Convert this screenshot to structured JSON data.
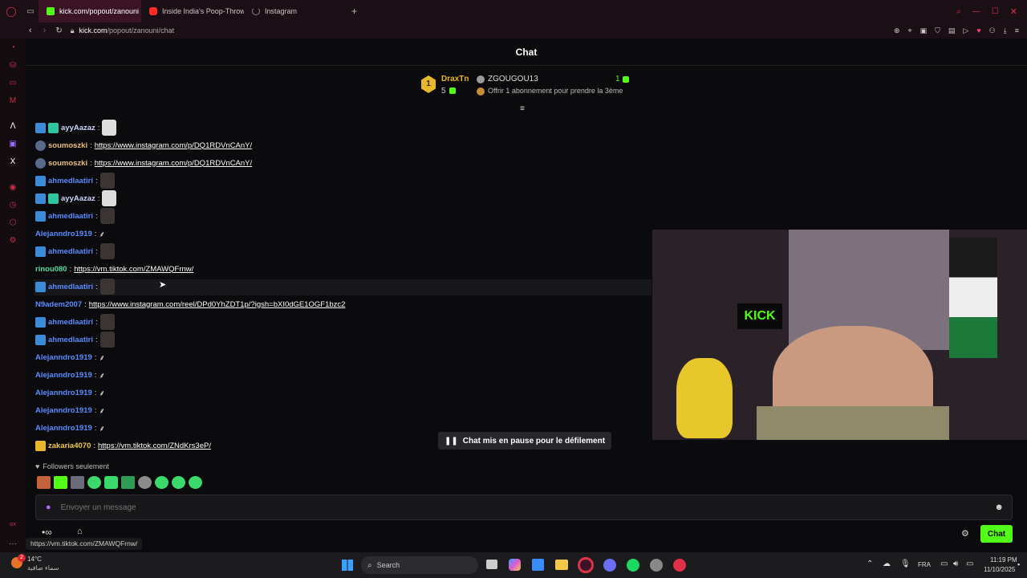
{
  "browser": {
    "tabs": [
      {
        "label": "kick.com/popout/zanouni"
      },
      {
        "label": "Inside India's Poop-Throw"
      },
      {
        "label": "Instagram"
      }
    ],
    "url_host": "kick.com",
    "url_path": "/popout/zanouni/chat"
  },
  "chat": {
    "title": "Chat",
    "leaderboard": {
      "first_rank": "1",
      "first_name": "DraxTn",
      "first_count": "5",
      "second_name": "ZGOUGOU13",
      "second_count": "1",
      "offer_text": "Offrir 1 abonnement pour prendre la 3ème"
    },
    "messages": [
      {
        "user": "ayyAazaz",
        "user_color": "#cfd6ff",
        "text": ""
      },
      {
        "user": "soumoszki",
        "user_color": "#e8c07a",
        "text": "https://www.instagram.com/p/DQ1RDVnCAnY/"
      },
      {
        "user": "soumoszki",
        "user_color": "#e8c07a",
        "text": "https://www.instagram.com/p/DQ1RDVnCAnY/"
      },
      {
        "user": "ahmedlaatiri",
        "user_color": "#5a8cff",
        "text": ""
      },
      {
        "user": "ayyAazaz",
        "user_color": "#cfd6ff",
        "text": ""
      },
      {
        "user": "ahmedlaatiri",
        "user_color": "#5a8cff",
        "text": ""
      },
      {
        "user": "Alejanndro1919",
        "user_color": "#5a8cff",
        "text": ""
      },
      {
        "user": "ahmedlaatiri",
        "user_color": "#5a8cff",
        "text": ""
      },
      {
        "user": "rinou080",
        "user_color": "#59d9a0",
        "text": "https://vm.tiktok.com/ZMAWQFrnw/"
      },
      {
        "user": "ahmedlaatiri",
        "user_color": "#5a8cff",
        "text": ""
      },
      {
        "user": "N9adem2007",
        "user_color": "#5a8cff",
        "text": "https://www.instagram.com/reel/DPd0YhZDT1p/?igsh=bXI0dGE1OGF1bzc2"
      },
      {
        "user": "ahmedlaatiri",
        "user_color": "#5a8cff",
        "text": ""
      },
      {
        "user": "ahmedlaatiri",
        "user_color": "#5a8cff",
        "text": ""
      },
      {
        "user": "Alejanndro1919",
        "user_color": "#5a8cff",
        "text": ""
      },
      {
        "user": "Alejanndro1919",
        "user_color": "#5a8cff",
        "text": ""
      },
      {
        "user": "Alejanndro1919",
        "user_color": "#5a8cff",
        "text": ""
      },
      {
        "user": "Alejanndro1919",
        "user_color": "#5a8cff",
        "text": ""
      },
      {
        "user": "Alejanndro1919",
        "user_color": "#5a8cff",
        "text": ""
      },
      {
        "user": "zakaria4070",
        "user_color": "#f2c84b",
        "text": "https://vm.tiktok.com/ZNdKrs3eP/"
      }
    ],
    "paused_label": "Chat mis en pause pour le défilement",
    "followers_only": "Followers seulement",
    "input_placeholder": "Envoyer un message",
    "send_label": "Chat",
    "hover_link": "https://vm.tiktok.com/ZMAWQFrnw/"
  },
  "video": {
    "overlay_text": "KICK"
  },
  "taskbar": {
    "weather_temp": "14°C",
    "weather_desc": "سماء صافية",
    "weather_badge": "2",
    "search_label": "Search",
    "lang": "FRA",
    "time": "11:19 PM",
    "date": "11/10/2025"
  },
  "colors": {
    "kick_green": "#53fc18",
    "browser_red": "#e0304a"
  }
}
